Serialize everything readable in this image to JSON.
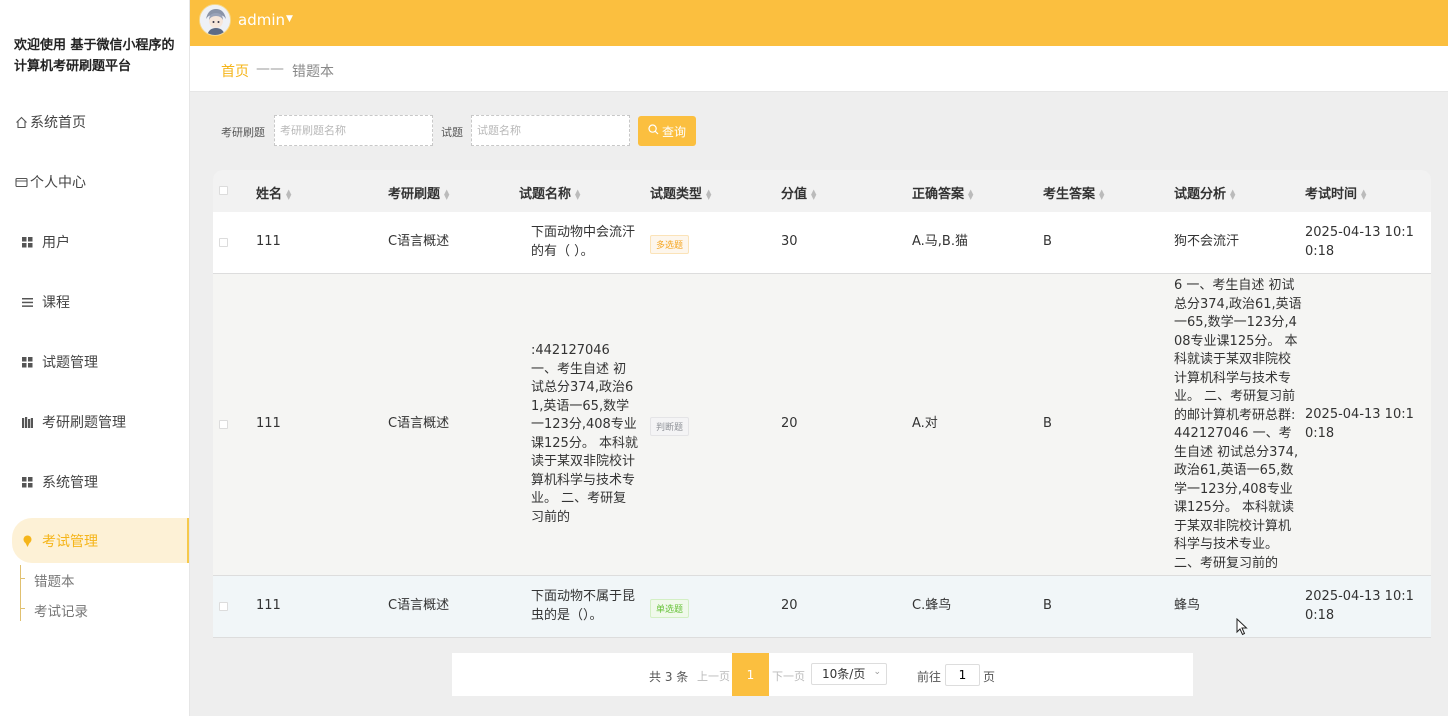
{
  "sidebar": {
    "brand": "欢迎使用 基于微信小程序的计算机考研刷题平台",
    "items": [
      {
        "label": "系统首页",
        "icon": "home-icon"
      },
      {
        "label": "个人中心",
        "icon": "card-icon"
      },
      {
        "label": "用户",
        "icon": "grid-icon"
      },
      {
        "label": "课程",
        "icon": "list-icon"
      },
      {
        "label": "试题管理",
        "icon": "grid-icon"
      },
      {
        "label": "考研刷题管理",
        "icon": "books-icon"
      },
      {
        "label": "系统管理",
        "icon": "grid-icon"
      },
      {
        "label": "考试管理",
        "icon": "pin-icon"
      }
    ],
    "subitems": [
      {
        "label": "错题本"
      },
      {
        "label": "考试记录"
      }
    ]
  },
  "topbar": {
    "username": "admin"
  },
  "breadcrumb": {
    "home": "首页",
    "separator": "——",
    "current": "错题本"
  },
  "search": {
    "label1": "考研刷题",
    "placeholder1": "考研刷题名称",
    "label2": "试题",
    "placeholder2": "试题名称",
    "button": "查询"
  },
  "table": {
    "headers": [
      "姓名",
      "考研刷题",
      "试题名称",
      "试题类型",
      "分值",
      "正确答案",
      "考生答案",
      "试题分析",
      "考试时间"
    ],
    "rows": [
      {
        "name": "111",
        "exam": "C语言概述",
        "question": "下面动物中会流汗的有（ ）。",
        "type": "多选题",
        "score": "30",
        "correct": "A.马,B.猫",
        "answer": "B",
        "analysis": "狗不会流汗",
        "time": "2025-04-13 10:10:18"
      },
      {
        "name": "111",
        "exam": "C语言概述",
        "question": ":442127046 一、考生自述 初试总分374,政治61,英语一65,数学一123分,408专业课125分。 本科就读于某双非院校计算机科学与技术专业。 二、考研复习前的",
        "type": "判断题",
        "score": "20",
        "correct": "A.对",
        "answer": "B",
        "analysis": "6 一、考生自述 初试总分374,政治61,英语一65,数学一123分,408专业课125分。 本科就读于某双非院校计算机科学与技术专业。 二、考研复习前的邮计算机考研总群:442127046 一、考生自述 初试总分374,政治61,英语一65,数学一123分,408专业课125分。 本科就读于某双非院校计算机科学与技术专业。 二、考研复习前的",
        "time": "2025-04-13 10:10:18"
      },
      {
        "name": "111",
        "exam": "C语言概述",
        "question": "下面动物不属于昆虫的是（）。",
        "type": "单选题",
        "score": "20",
        "correct": "C.蜂鸟",
        "answer": "B",
        "analysis": "蜂鸟",
        "time": "2025-04-13 10:10:18"
      }
    ]
  },
  "pagination": {
    "total": "共 3 条",
    "prev": "上一页",
    "current": "1",
    "next": "下一页",
    "page_size": "10条/页",
    "goto": "前往",
    "goto_value": "1",
    "unit": "页"
  },
  "colors": {
    "accent": "#fbbf3f",
    "multi_badge": "#f5a623",
    "judge_badge": "#909399",
    "single_badge": "#67c23a"
  }
}
